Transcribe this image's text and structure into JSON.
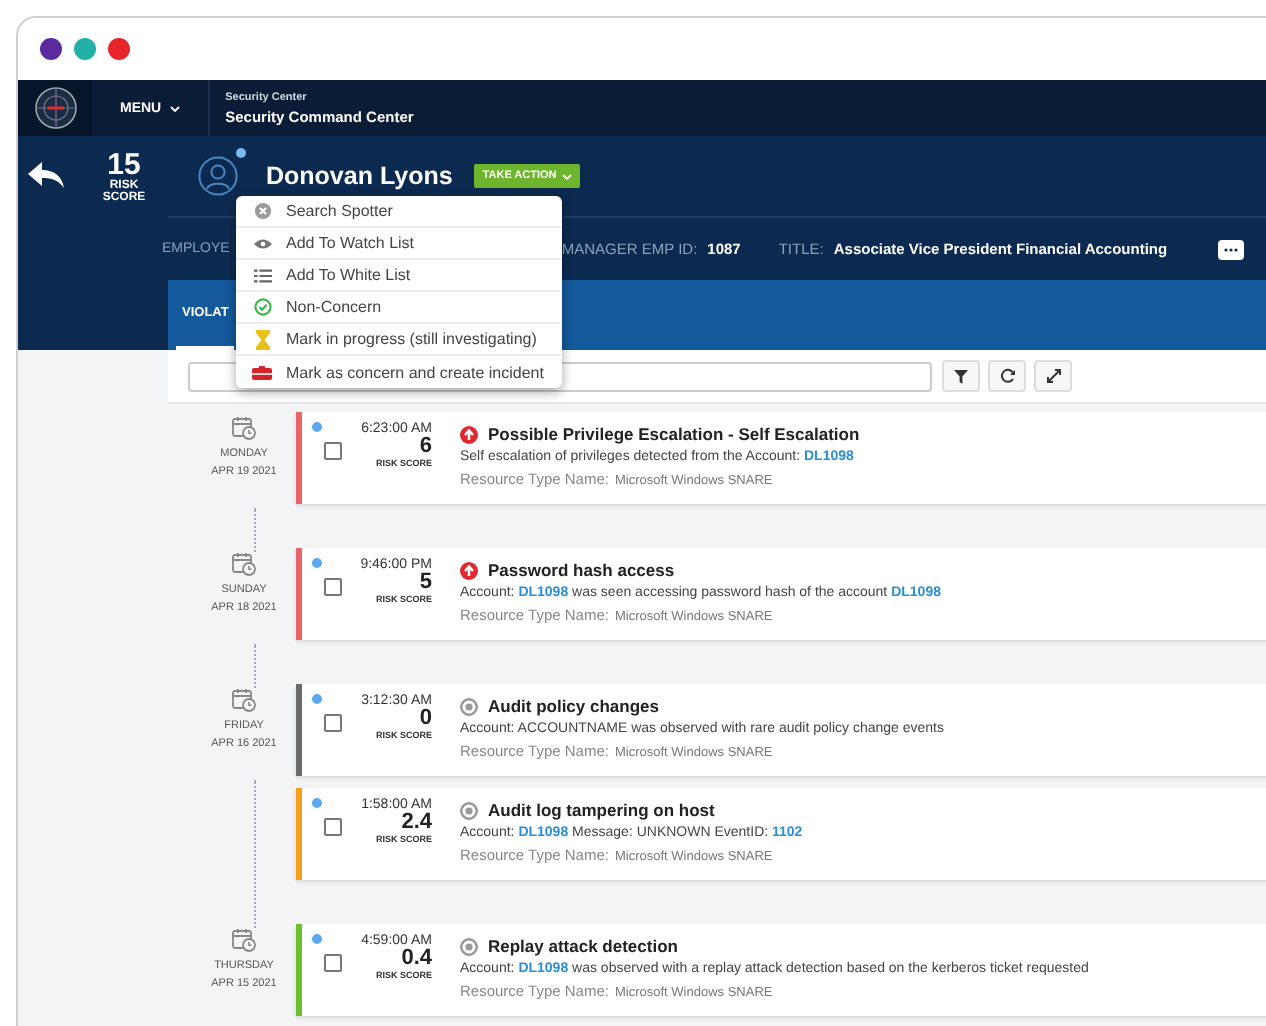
{
  "window": {
    "dots": [
      {
        "color": "#5b2a9e"
      },
      {
        "color": "#23b0a8"
      },
      {
        "color": "#e8262b"
      }
    ]
  },
  "nav": {
    "menu": "MENU",
    "subtitle": "Security Center",
    "title": "Security Command Center"
  },
  "header": {
    "risk_score": "15",
    "risk_label": "RISK SCORE",
    "online": true,
    "name": "Donovan Lyons",
    "action": "TAKE ACTION"
  },
  "info": [
    {
      "label": "EMPLOYE"
    },
    {
      "label": "MANAGER EMP ID:",
      "value": "1087"
    },
    {
      "label": "TITLE:",
      "value": "Associate Vice President Financial Accounting"
    }
  ],
  "tabs": [
    {
      "label": "VIOLAT",
      "selected": true
    }
  ],
  "menu": [
    {
      "kind": "spotter",
      "label": "Search Spotter"
    },
    {
      "kind": "watch",
      "label": "Add To Watch List"
    },
    {
      "kind": "white",
      "label": "Add To White List"
    },
    {
      "kind": "nonconcern",
      "label": "Non-Concern"
    },
    {
      "kind": "progress",
      "label": "Mark in progress (still investigating)"
    },
    {
      "kind": "incident",
      "label": "Mark as concern and create incident"
    }
  ],
  "groups": [
    {
      "day": "MONDAY",
      "date": "APR 19 2021",
      "events": [
        {
          "unread": true,
          "checked": false,
          "time": "6:23:00 AM",
          "score": "6",
          "score_label": "RISK SCORE",
          "kind": "high",
          "color": "#e8646a",
          "title": "Possible Privilege Escalation - Self Escalation",
          "description": [
            {
              "kind": "text",
              "text": "Self escalation of privileges detected from the Account:"
            },
            {
              "kind": "link",
              "text": "DL1098"
            }
          ],
          "resource_label": "Resource Type Name:",
          "resource": "Microsoft Windows SNARE"
        }
      ]
    },
    {
      "day": "SUNDAY",
      "date": "APR 18 2021",
      "events": [
        {
          "unread": true,
          "checked": false,
          "time": "9:46:00 PM",
          "score": "5",
          "score_label": "RISK SCORE",
          "kind": "high",
          "color": "#e8646a",
          "title": "Password hash access",
          "description": [
            {
              "kind": "text",
              "text": "Account:"
            },
            {
              "kind": "link",
              "text": "DL1098"
            },
            {
              "kind": "text",
              "text": "was seen accessing password hash of the account"
            },
            {
              "kind": "link",
              "text": "DL1098"
            }
          ],
          "resource_label": "Resource Type Name:",
          "resource": "Microsoft Windows SNARE"
        }
      ]
    },
    {
      "day": "FRIDAY",
      "date": "APR 16 2021",
      "events": [
        {
          "unread": true,
          "checked": false,
          "time": "3:12:30 AM",
          "score": "0",
          "score_label": "RISK SCORE",
          "kind": "low",
          "color": "#6b6b6b",
          "title": "Audit policy changes",
          "description": [
            {
              "kind": "text",
              "text": "Account: ACCOUNTNAME was observed with rare audit policy change events"
            }
          ],
          "resource_label": "Resource Type Name:",
          "resource": "Microsoft Windows SNARE"
        },
        {
          "unread": true,
          "checked": false,
          "time": "1:58:00 AM",
          "score": "2.4",
          "score_label": "RISK SCORE",
          "kind": "low",
          "color": "#f5a01a",
          "title": "Audit log tampering on host",
          "description": [
            {
              "kind": "text",
              "text": "Account:"
            },
            {
              "kind": "link",
              "text": "DL1098"
            },
            {
              "kind": "text",
              "text": "Message: UNKNOWN EventID:"
            },
            {
              "kind": "link",
              "text": "1102"
            }
          ],
          "resource_label": "Resource Type Name:",
          "resource": "Microsoft Windows SNARE"
        }
      ]
    },
    {
      "day": "THURSDAY",
      "date": "APR 15 2021",
      "events": [
        {
          "unread": true,
          "checked": false,
          "time": "4:59:00 AM",
          "score": "0.4",
          "score_label": "RISK SCORE",
          "kind": "low",
          "color": "#6cbf2e",
          "title": "Replay attack detection",
          "description": [
            {
              "kind": "text",
              "text": "Account:"
            },
            {
              "kind": "link",
              "text": "DL1098"
            },
            {
              "kind": "text",
              "text": "was observed with a replay attack detection based on the kerberos ticket requested"
            }
          ],
          "resource_label": "Resource Type Name:",
          "resource": "Microsoft Windows SNARE"
        }
      ]
    }
  ]
}
